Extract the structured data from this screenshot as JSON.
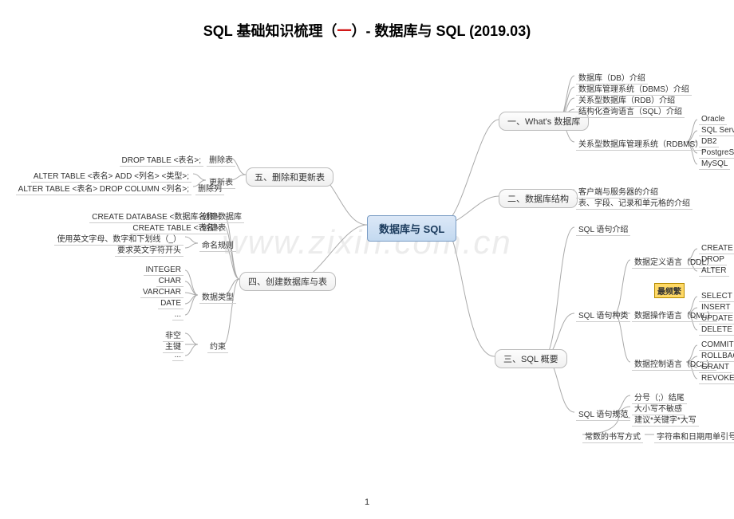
{
  "title_a": "SQL 基础知识梳理（",
  "title_b": "一",
  "title_c": "）- 数据库与 SQL  (2019.03)",
  "watermark": "www.zixin.com.cn",
  "page_number": "1",
  "center": "数据库与 SQL",
  "branches": {
    "b1": "一、What's 数据库",
    "b2": "二、数据库结构",
    "b3": "三、SQL 概要",
    "b4": "四、创建数据库与表",
    "b5": "五、删除和更新表"
  },
  "b1": {
    "n1": "数据库（DB）介绍",
    "n2": "数据库管理系统（DBMS）介绍",
    "n3": "关系型数据库（RDB）介绍",
    "n4": "结构化查询语言（SQL）介绍",
    "n5": "关系型数据库管理系统（RDBMS）",
    "rdbms": {
      "r1": "Oracle",
      "r2": "SQL Server",
      "r3": "DB2",
      "r4": "PostgreSQL",
      "r5": "MySQL"
    }
  },
  "b2": {
    "n1": "客户端与服务器的介绍",
    "n2": "表、字段、记录和单元格的介绍"
  },
  "b3": {
    "n1": "SQL 语句介绍",
    "n2": "SQL 语句种类",
    "n3": "SQL 语句规范",
    "ddl": "数据定义语言（DDL）",
    "dml": "数据操作语言（DML）",
    "dcl": "数据控制语言（DCL）",
    "ddl_items": {
      "d1": "CREATE",
      "d2": "DROP",
      "d3": "ALTER"
    },
    "most": "最频繁",
    "dml_items": {
      "d1": "SELECT",
      "d2": "INSERT",
      "d3": "UPDATE",
      "d4": "DELETE"
    },
    "dcl_items": {
      "d1": "COMMIT",
      "d2": "ROLLBACK",
      "d3": "GRANT",
      "d4": "REVOKE"
    },
    "rules": {
      "r1": "分号（;）结尾",
      "r2": "大小写不敏感",
      "r3": "建议*关键字*大写",
      "r4label": "常数的书写方式",
      "r4": "字符串和日期用单引号括起来（'）"
    }
  },
  "b4": {
    "n1label": "CREATE DATABASE <数据库名称>;",
    "n1": "创建数据库",
    "n2label": "CREATE TABLE <表名>;",
    "n2": "创建表",
    "naming_label": "命名规则",
    "naming": {
      "r1": "使用英文字母、数字和下划线（_）",
      "r2": "要求英文字符开头"
    },
    "types_label": "数据类型",
    "types": {
      "t1": "INTEGER",
      "t2": "CHAR",
      "t3": "VARCHAR",
      "t4": "DATE",
      "t5": "..."
    },
    "cons_label": "约束",
    "cons": {
      "c1": "非空",
      "c2": "主键",
      "c3": "..."
    }
  },
  "b5": {
    "n1label": "DROP TABLE <表名>;",
    "n1": "删除表",
    "n2": "更新表",
    "n2a": "ALTER TABLE <表名> ADD <列名> <类型>;",
    "n2b": "ALTER TABLE <表名> DROP COLUMN <列名>;",
    "n2bL": "删除列"
  }
}
